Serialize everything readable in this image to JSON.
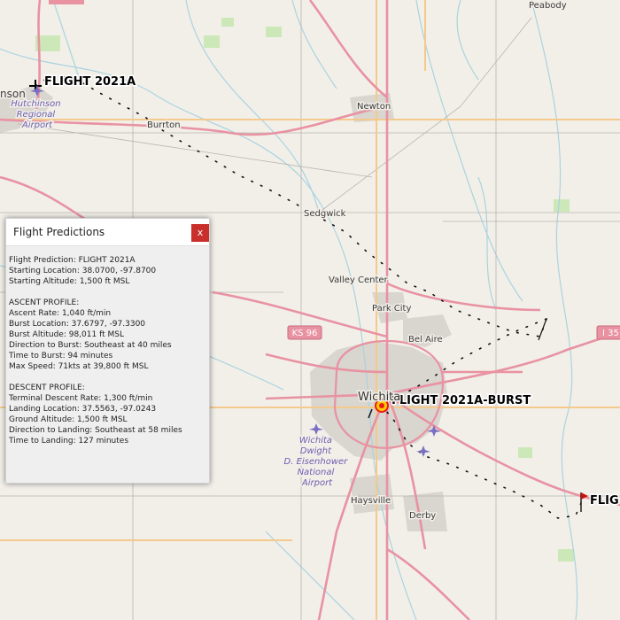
{
  "map": {
    "towns": [
      {
        "name": "Peabody"
      },
      {
        "name": "Newton"
      },
      {
        "name": "Burrton"
      },
      {
        "name": "Sedgwick"
      },
      {
        "name": "Valley Center"
      },
      {
        "name": "Park City"
      },
      {
        "name": "Bel Aire"
      },
      {
        "name": "Haysville"
      },
      {
        "name": "Derby"
      },
      {
        "name": "nson"
      }
    ],
    "city": "Wichita",
    "airports": [
      {
        "lines": [
          "Hutchinson",
          "Regional",
          "Airport"
        ]
      },
      {
        "lines": [
          "Wichita",
          "Dwight",
          "D. Eisenhower",
          "National",
          "Airport"
        ]
      }
    ],
    "shields": {
      "ks96": "KS 96",
      "i35": "I 35"
    },
    "flight_labels": {
      "start": "FLIGHT 2021A",
      "burst": "FLIGHT 2021A-BURST",
      "landing": "FLIG"
    },
    "colors": {
      "land": "#f2efe9",
      "major_road": "#e892a2",
      "secondary_road": "#f7c87c",
      "water": "#aad3df",
      "urban": "#d6d2cc",
      "park": "#c8e6b0",
      "airport_icon": "#7a6fc2",
      "burst_marker": "#e81b1b",
      "landing_flag": "#c81010",
      "close_button": "#c9302c"
    }
  },
  "panel": {
    "title": "Flight Predictions",
    "close_label": "x",
    "lines": [
      "Flight Prediction: FLIGHT 2021A",
      "Starting Location: 38.0700, -97.8700",
      "Starting Altitude: 1,500 ft MSL",
      "",
      "ASCENT PROFILE:",
      "Ascent Rate: 1,040 ft/min",
      "Burst Location: 37.6797, -97.3300",
      "Burst Altitude: 98,011 ft MSL",
      "Direction to Burst: Southeast at 40 miles",
      "Time to Burst: 94 minutes",
      "Max Speed: 71kts at 39,800 ft MSL",
      "",
      "DESCENT PROFILE:",
      "Terminal Descent Rate: 1,300 ft/min",
      "Landing Location: 37.5563, -97.0243",
      "Ground Altitude: 1,500 ft MSL",
      "Direction to Landing: Southeast at 58 miles",
      "Time to Landing: 127 minutes"
    ]
  }
}
